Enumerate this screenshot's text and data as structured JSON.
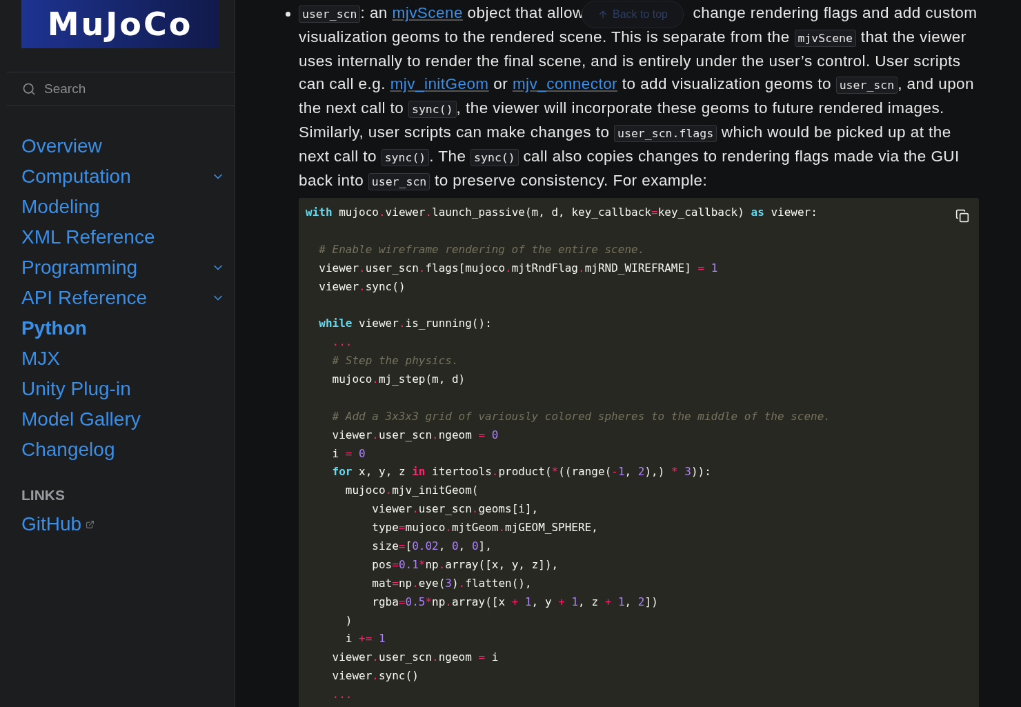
{
  "sidebar": {
    "logo": "MuJoCo",
    "search": {
      "placeholder": "Search"
    },
    "nav": [
      {
        "label": "Overview",
        "selected": false
      },
      {
        "label": "Computation",
        "selected": false,
        "expanded": false
      },
      {
        "label": "Modeling",
        "selected": false
      },
      {
        "label": "XML Reference",
        "selected": false
      },
      {
        "label": "Programming",
        "selected": false,
        "expanded": false
      },
      {
        "label": "API Reference",
        "selected": false,
        "expanded": false
      },
      {
        "label": "Python",
        "selected": true
      },
      {
        "label": "MJX",
        "selected": false
      },
      {
        "label": "Unity Plug-in",
        "selected": false
      },
      {
        "label": "Model Gallery",
        "selected": false
      },
      {
        "label": "Changelog",
        "selected": false
      }
    ],
    "links_heading": "LINKS",
    "links": [
      {
        "label": "GitHub",
        "external": true
      }
    ]
  },
  "back_to_top": {
    "label": "Back to top"
  },
  "paragraph": [
    {
      "kind": "code",
      "text": "user_scn"
    },
    {
      "kind": "text",
      "text": ": an "
    },
    {
      "kind": "link",
      "text": "mjvScene"
    },
    {
      "kind": "text",
      "text": " object that allow"
    },
    {
      "kind": "gap"
    },
    {
      "kind": "text",
      "text": "change rendering flags and add custom visualization geoms to the rendered scene. This is separate from the "
    },
    {
      "kind": "code",
      "text": "mjvScene"
    },
    {
      "kind": "text",
      "text": " that the viewer uses internally to render the final scene, and is entirely under the user’s control. User scripts can call e.g. "
    },
    {
      "kind": "link",
      "text": "mjv_initGeom"
    },
    {
      "kind": "text",
      "text": " or "
    },
    {
      "kind": "link",
      "text": "mjv_connector"
    },
    {
      "kind": "text",
      "text": " to add visualization geoms to "
    },
    {
      "kind": "code",
      "text": "user_scn"
    },
    {
      "kind": "text",
      "text": ", and upon the next call to "
    },
    {
      "kind": "code",
      "text": "sync()"
    },
    {
      "kind": "text",
      "text": ", the viewer will incorporate these geoms to future rendered images. Similarly, user scripts can make changes to "
    },
    {
      "kind": "code",
      "text": "user_scn.flags"
    },
    {
      "kind": "text",
      "text": " which would be picked up at the next call to "
    },
    {
      "kind": "code",
      "text": "sync()"
    },
    {
      "kind": "text",
      "text": ". The "
    },
    {
      "kind": "code",
      "text": "sync()"
    },
    {
      "kind": "text",
      "text": " call also copies changes to rendering flags made via the GUI back into "
    },
    {
      "kind": "code",
      "text": "user_scn"
    },
    {
      "kind": "text",
      "text": " to preserve consistency. For example:"
    }
  ],
  "code": [
    {
      "kind": "code",
      "text": "with mujoco.viewer.launch_passive(m, d, key_callback=key_callback) as viewer:"
    },
    {
      "kind": "blank"
    },
    {
      "kind": "code",
      "text": "  # Enable wireframe rendering of the entire scene."
    },
    {
      "kind": "code",
      "text": "  viewer.user_scn.flags[mujoco.mjtRndFlag.mjRND_WIREFRAME] = 1"
    },
    {
      "kind": "code",
      "text": "  viewer.sync()"
    },
    {
      "kind": "blank"
    },
    {
      "kind": "code",
      "text": "  while viewer.is_running():"
    },
    {
      "kind": "code",
      "text": "    ..."
    },
    {
      "kind": "code",
      "text": "    # Step the physics."
    },
    {
      "kind": "code",
      "text": "    mujoco.mj_step(m, d)"
    },
    {
      "kind": "blank"
    },
    {
      "kind": "code",
      "text": "    # Add a 3x3x3 grid of variously colored spheres to the middle of the scene."
    },
    {
      "kind": "code",
      "text": "    viewer.user_scn.ngeom = 0"
    },
    {
      "kind": "code",
      "text": "    i = 0"
    },
    {
      "kind": "code",
      "text": "    for x, y, z in itertools.product(*((range(-1, 2),) * 3)):"
    },
    {
      "kind": "code",
      "text": "      mujoco.mjv_initGeom("
    },
    {
      "kind": "code",
      "text": "          viewer.user_scn.geoms[i],"
    },
    {
      "kind": "code",
      "text": "          type=mujoco.mjtGeom.mjGEOM_SPHERE,"
    },
    {
      "kind": "code",
      "text": "          size=[0.02, 0, 0],"
    },
    {
      "kind": "code",
      "text": "          pos=0.1*np.array([x, y, z]),"
    },
    {
      "kind": "code",
      "text": "          mat=np.eye(3).flatten(),"
    },
    {
      "kind": "code",
      "text": "          rgba=0.5*np.array([x + 1, y + 1, z + 1, 2])"
    },
    {
      "kind": "code",
      "text": "      )"
    },
    {
      "kind": "code",
      "text": "      i += 1"
    },
    {
      "kind": "code",
      "text": "    viewer.user_scn.ngeom = i"
    },
    {
      "kind": "code",
      "text": "    viewer.sync()"
    },
    {
      "kind": "code",
      "text": "    ..."
    }
  ]
}
